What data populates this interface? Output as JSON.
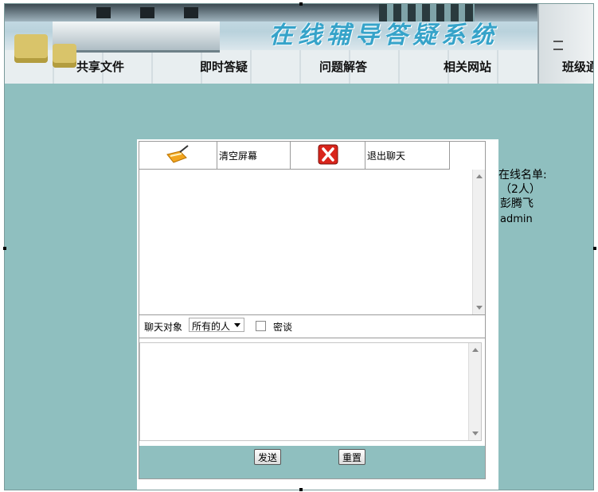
{
  "banner": {
    "title": "在线辅导答疑系统",
    "nav": [
      "共享文件",
      "即时答疑",
      "问题解答",
      "相关网站",
      "班级通"
    ]
  },
  "toolbar": {
    "clear_label": "清空屏幕",
    "exit_label": "退出聊天",
    "clear_icon": "broom-icon",
    "exit_icon": "red-x-icon"
  },
  "chat": {
    "target_label": "聊天对象",
    "target_value": "所有的人",
    "private_label": "密谈",
    "private_checked": false,
    "send_label": "发送",
    "reset_label": "重置"
  },
  "online": {
    "title": "在线名单:",
    "count": "（2人）",
    "users": [
      "彭腾飞",
      "admin"
    ]
  },
  "colors": {
    "panel_bg": "#8fbfbf",
    "title_color": "#36a3c9",
    "exit_red": "#d9251c"
  }
}
